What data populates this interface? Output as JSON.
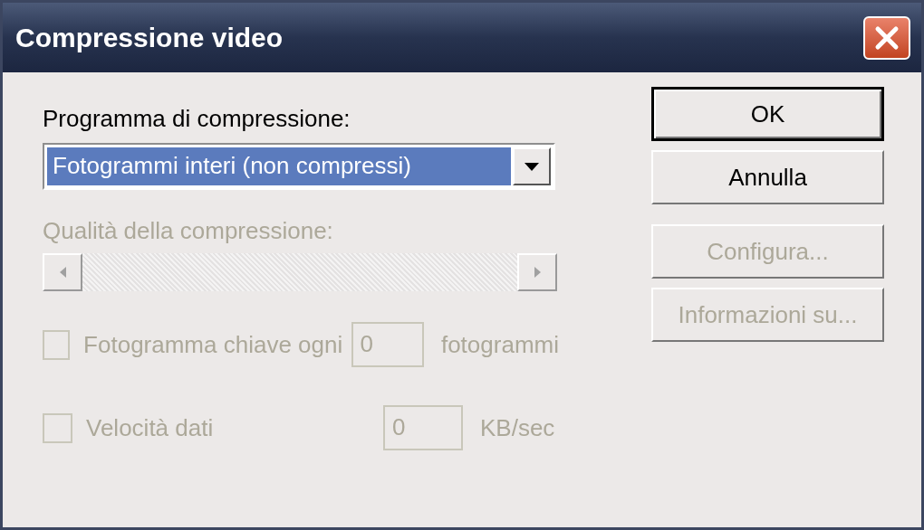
{
  "window": {
    "title": "Compressione video"
  },
  "compressor": {
    "label": "Programma di compressione:",
    "value": "Fotogrammi interi (non compressi)"
  },
  "quality": {
    "label": "Qualità della compressione:",
    "disabled": true
  },
  "options": [
    {
      "label": "Fotogramma chiave ogni",
      "checked": false,
      "disabled": true,
      "value": "0",
      "unit": "fotogrammi"
    },
    {
      "label": "Velocità dati",
      "checked": false,
      "disabled": true,
      "value": "0",
      "unit": "KB/sec"
    }
  ],
  "buttons": [
    {
      "label": "OK",
      "default": true,
      "disabled": false
    },
    {
      "label": "Annulla",
      "default": false,
      "disabled": false
    },
    {
      "label": "Configura...",
      "default": false,
      "disabled": true
    },
    {
      "label": "Informazioni su...",
      "default": false,
      "disabled": true
    }
  ]
}
